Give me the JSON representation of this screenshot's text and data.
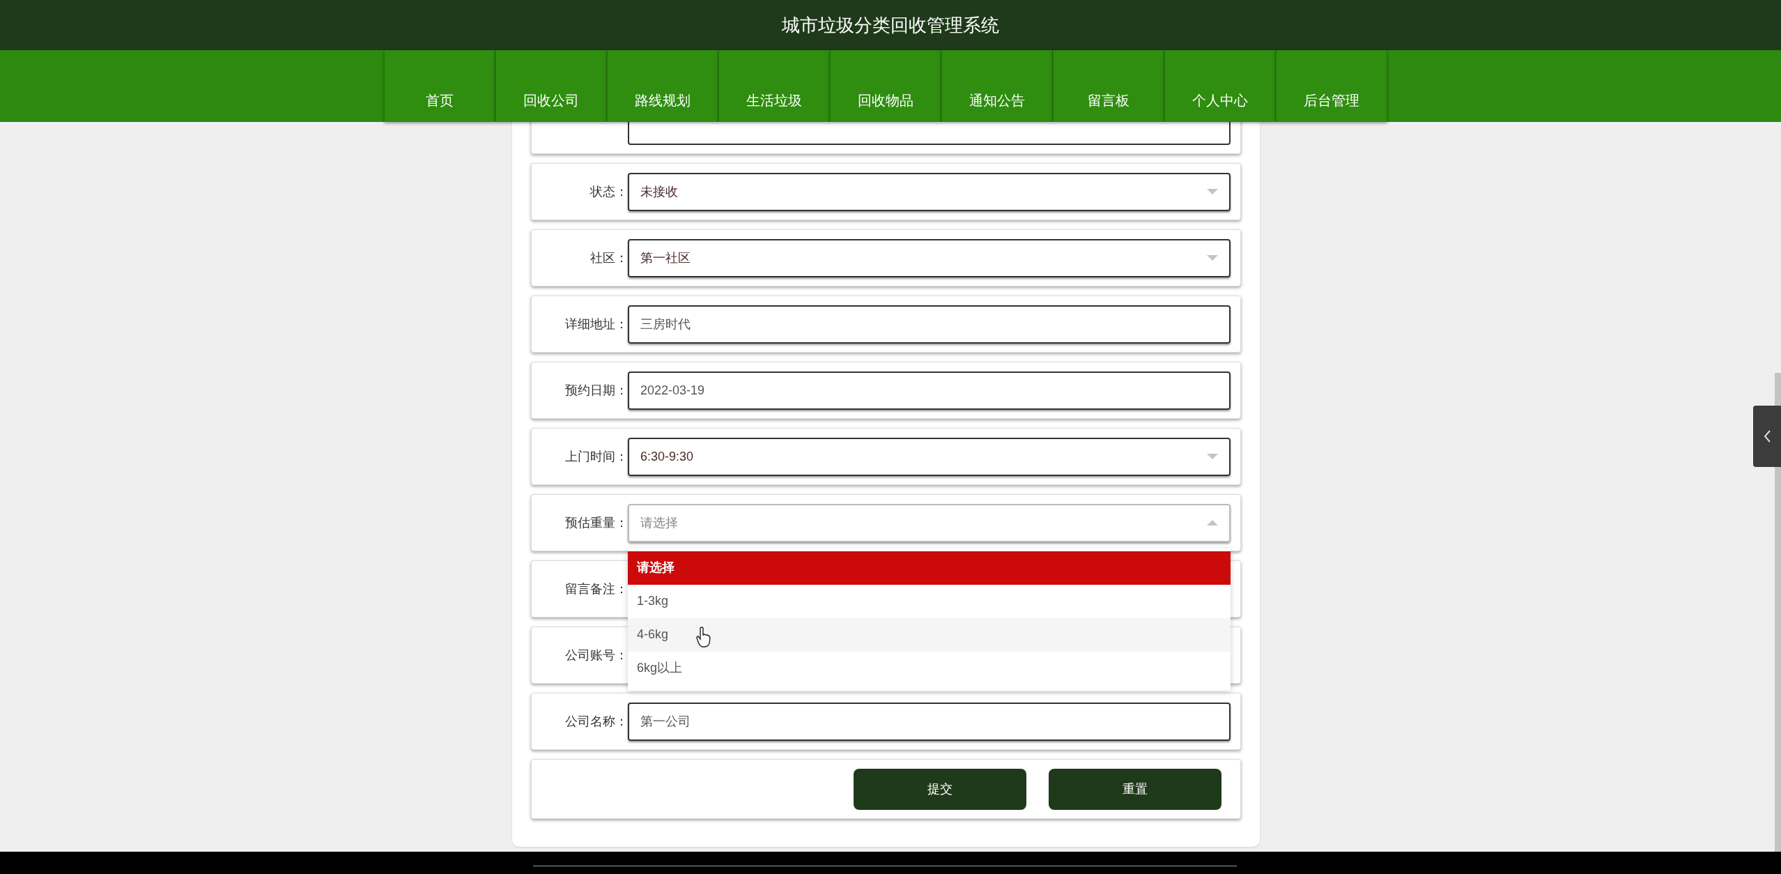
{
  "header": {
    "title": "城市垃圾分类回收管理系统"
  },
  "nav": [
    {
      "label": "首页"
    },
    {
      "label": "回收公司"
    },
    {
      "label": "路线规划"
    },
    {
      "label": "生活垃圾"
    },
    {
      "label": "回收物品"
    },
    {
      "label": "通知公告"
    },
    {
      "label": "留言板"
    },
    {
      "label": "个人中心"
    },
    {
      "label": "后台管理"
    }
  ],
  "form": {
    "fields": [
      {
        "kind": "covered"
      },
      {
        "label": "状态：",
        "kind": "select",
        "value": "未接收",
        "expanded": false
      },
      {
        "label": "社区：",
        "kind": "select",
        "value": "第一社区",
        "expanded": false
      },
      {
        "label": "详细地址：",
        "kind": "text",
        "value": "三房时代"
      },
      {
        "label": "预约日期：",
        "kind": "text",
        "value": "2022-03-19"
      },
      {
        "label": "上门时间：",
        "kind": "select",
        "value": "6:30-9:30",
        "expanded": false
      },
      {
        "label": "预估重量：",
        "kind": "select",
        "placeholder": "请选择",
        "expanded": true,
        "options": [
          {
            "label": "请选择",
            "selected": true,
            "hovered": false
          },
          {
            "label": "1-3kg",
            "selected": false,
            "hovered": false
          },
          {
            "label": "4-6kg",
            "selected": false,
            "hovered": true
          },
          {
            "label": "6kg以上",
            "selected": false,
            "hovered": false
          }
        ]
      },
      {
        "label": "留言备注：",
        "kind": "covered"
      },
      {
        "label": "公司账号：",
        "kind": "covered"
      },
      {
        "label": "公司名称：",
        "kind": "text",
        "value": "第一公司"
      }
    ],
    "buttons": [
      "提交",
      "重置"
    ]
  }
}
